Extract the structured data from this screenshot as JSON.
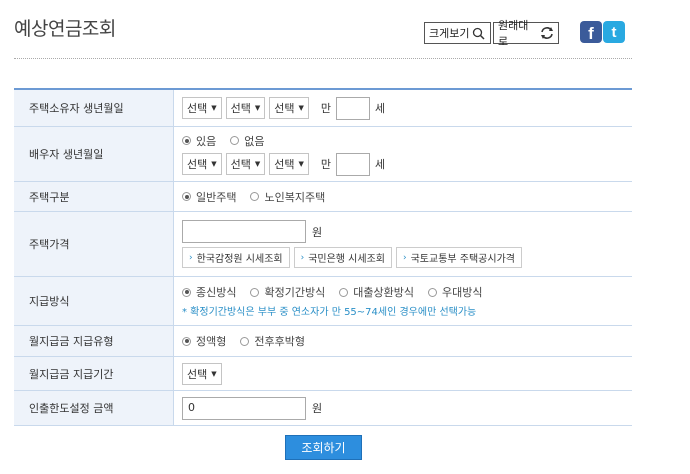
{
  "title": "예상연금조회",
  "toolbar": {
    "zoom_label": "크게보기",
    "reset_label": "원래대로",
    "facebook_glyph": "f",
    "twitter_glyph": "t"
  },
  "colors": {
    "accent": "#2d8ede",
    "facebook": "#3b5b9a",
    "twitter": "#29a9e1",
    "note": "#2a8fc7"
  },
  "rows": {
    "owner_birth": {
      "label": "주택소유자 생년월일",
      "sel1": "선택",
      "sel2": "선택",
      "sel3": "선택",
      "age_prefix": "만",
      "age_value": "",
      "age_suffix": "세"
    },
    "spouse_birth": {
      "label": "배우자 생년월일",
      "opt_yes": "있음",
      "opt_no": "없음",
      "sel1": "선택",
      "sel2": "선택",
      "sel3": "선택",
      "age_prefix": "만",
      "age_value": "",
      "age_suffix": "세"
    },
    "house_type": {
      "label": "주택구분",
      "opt1": "일반주택",
      "opt2": "노인복지주택"
    },
    "house_price": {
      "label": "주택가격",
      "value": "",
      "unit": "원",
      "btn1": "한국감정원 시세조회",
      "btn2": "국민은행 시세조회",
      "btn3": "국토교통부 주택공시가격"
    },
    "payment_method": {
      "label": "지급방식",
      "opt1": "종신방식",
      "opt2": "확정기간방식",
      "opt3": "대출상환방식",
      "opt4": "우대방식",
      "note": "* 확정기간방식은 부부 중 연소자가 만 55~74세인 경우에만 선택가능"
    },
    "monthly_type": {
      "label": "월지급금 지급유형",
      "opt1": "정액형",
      "opt2": "전후후박형"
    },
    "monthly_period": {
      "label": "월지급금 지급기간",
      "sel": "선택"
    },
    "withdraw_limit": {
      "label": "인출한도설정 금액",
      "value": "0",
      "unit": "원"
    }
  },
  "submit_label": "조회하기"
}
